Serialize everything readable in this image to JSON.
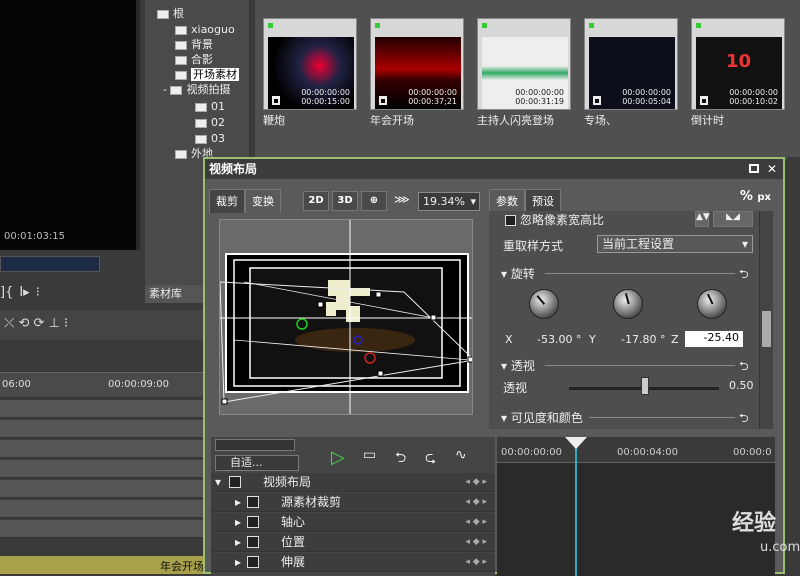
{
  "preview": {
    "timecode": "00:01:03:15"
  },
  "tree": {
    "items": [
      "根",
      "xiaoguo",
      "背景",
      "合影",
      "开场素材",
      "视频拍摄",
      "01",
      "02",
      "03",
      "外地"
    ]
  },
  "library_tab": "素材库",
  "bins": [
    {
      "label": "鞭炮",
      "duration": "00:00:00:00\n00:00:15:00"
    },
    {
      "label": "年会开场",
      "duration": "00:00:00:00\n00:00:37;21"
    },
    {
      "label": "主持人闪亮登场",
      "duration": "00:00:00:00\n00:00:31:19"
    },
    {
      "label": "专场、",
      "duration": "00:00:00:00\n00:00:05:04"
    },
    {
      "label": "倒计时",
      "duration": "00:00:00:00\n00:00:10:02"
    }
  ],
  "timeline": {
    "ruler": [
      "06:00",
      "00:00:09:00"
    ],
    "clip_label": "年会开场"
  },
  "dialog": {
    "title": "视频布局",
    "left_tabs": [
      "裁剪",
      "变换"
    ],
    "view_buttons": [
      "2D",
      "3D",
      "⊕"
    ],
    "zoom": "19.34%",
    "right_tabs": [
      "参数",
      "预设"
    ],
    "percent": "%",
    "px": "px",
    "ignore_aspect": "忽略像素宽高比",
    "resample_label": "重取样方式",
    "resample_value": "当前工程设置",
    "rotation_header": "旋转",
    "rot_x_label": "X",
    "rot_x": "-53.00 °",
    "rot_y_label": "Y",
    "rot_y": "-17.80 °",
    "rot_z_label": "Z",
    "rot_z": "-25.40",
    "perspective_header": "透视",
    "perspective_label": "透视",
    "perspective_value": "0.50",
    "visibility_header": "可见度和颜色",
    "kf_dropdown": "自适...",
    "kf_rows": [
      "视频布局",
      "源素材裁剪",
      "轴心",
      "位置",
      "伸展"
    ],
    "kf_times": [
      "00:00:00:00",
      "00:00:04:00",
      "00:00:0"
    ]
  },
  "watermark": "经验",
  "watermark2": "u.com"
}
